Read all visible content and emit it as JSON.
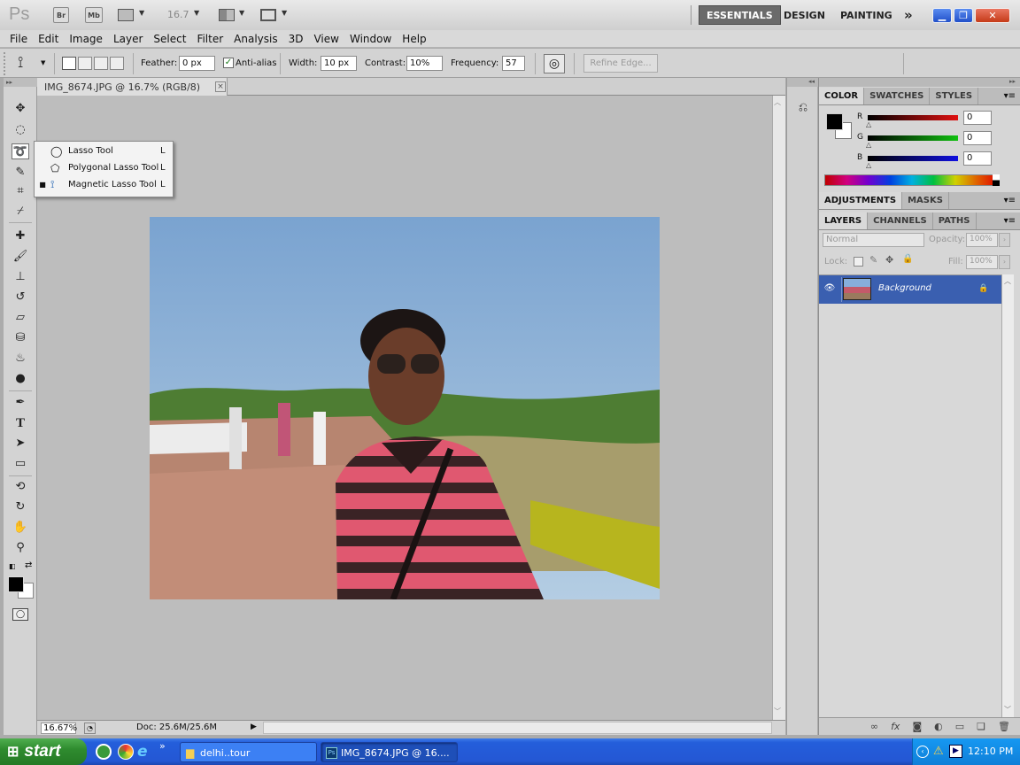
{
  "appbar": {
    "zoom_value": "16.7",
    "buttons": {
      "bridge": "Br",
      "minibridge": "Mb"
    },
    "workspaces": [
      "ESSENTIALS",
      "DESIGN",
      "PAINTING"
    ],
    "more": "»"
  },
  "menu": [
    "File",
    "Edit",
    "Image",
    "Layer",
    "Select",
    "Filter",
    "Analysis",
    "3D",
    "View",
    "Window",
    "Help"
  ],
  "options": {
    "feather_label": "Feather:",
    "feather_value": "0 px",
    "antialias_label": "Anti-alias",
    "width_label": "Width:",
    "width_value": "10 px",
    "contrast_label": "Contrast:",
    "contrast_value": "10%",
    "frequency_label": "Frequency:",
    "frequency_value": "57",
    "refine_edge": "Refine Edge..."
  },
  "document": {
    "tab_title": "IMG_8674.JPG @ 16.7% (RGB/8)",
    "status_zoom": "16.67%",
    "status_doc": "Doc: 25.6M/25.6M"
  },
  "flyout": {
    "items": [
      {
        "label": "Lasso Tool",
        "key": "L"
      },
      {
        "label": "Polygonal Lasso Tool",
        "key": "L"
      },
      {
        "label": "Magnetic Lasso Tool",
        "key": "L"
      }
    ],
    "selected_index": 2
  },
  "color_panel": {
    "tabs": [
      "COLOR",
      "SWATCHES",
      "STYLES"
    ],
    "channels": [
      {
        "label": "R",
        "value": "0",
        "color": "#d01010"
      },
      {
        "label": "G",
        "value": "0",
        "color": "#10b010"
      },
      {
        "label": "B",
        "value": "0",
        "color": "#1010d0"
      }
    ]
  },
  "adjust_panel": {
    "tabs": [
      "ADJUSTMENTS",
      "MASKS"
    ]
  },
  "layers_panel": {
    "tabs": [
      "LAYERS",
      "CHANNELS",
      "PATHS"
    ],
    "blend_mode": "Normal",
    "opacity_label": "Opacity:",
    "opacity_value": "100%",
    "lock_label": "Lock:",
    "fill_label": "Fill:",
    "fill_value": "100%",
    "layer_name": "Background"
  },
  "taskbar": {
    "start": "start",
    "tasks": [
      "delhi..tour",
      "IMG_8674.JPG @ 16...."
    ],
    "clock": "12:10 PM"
  }
}
